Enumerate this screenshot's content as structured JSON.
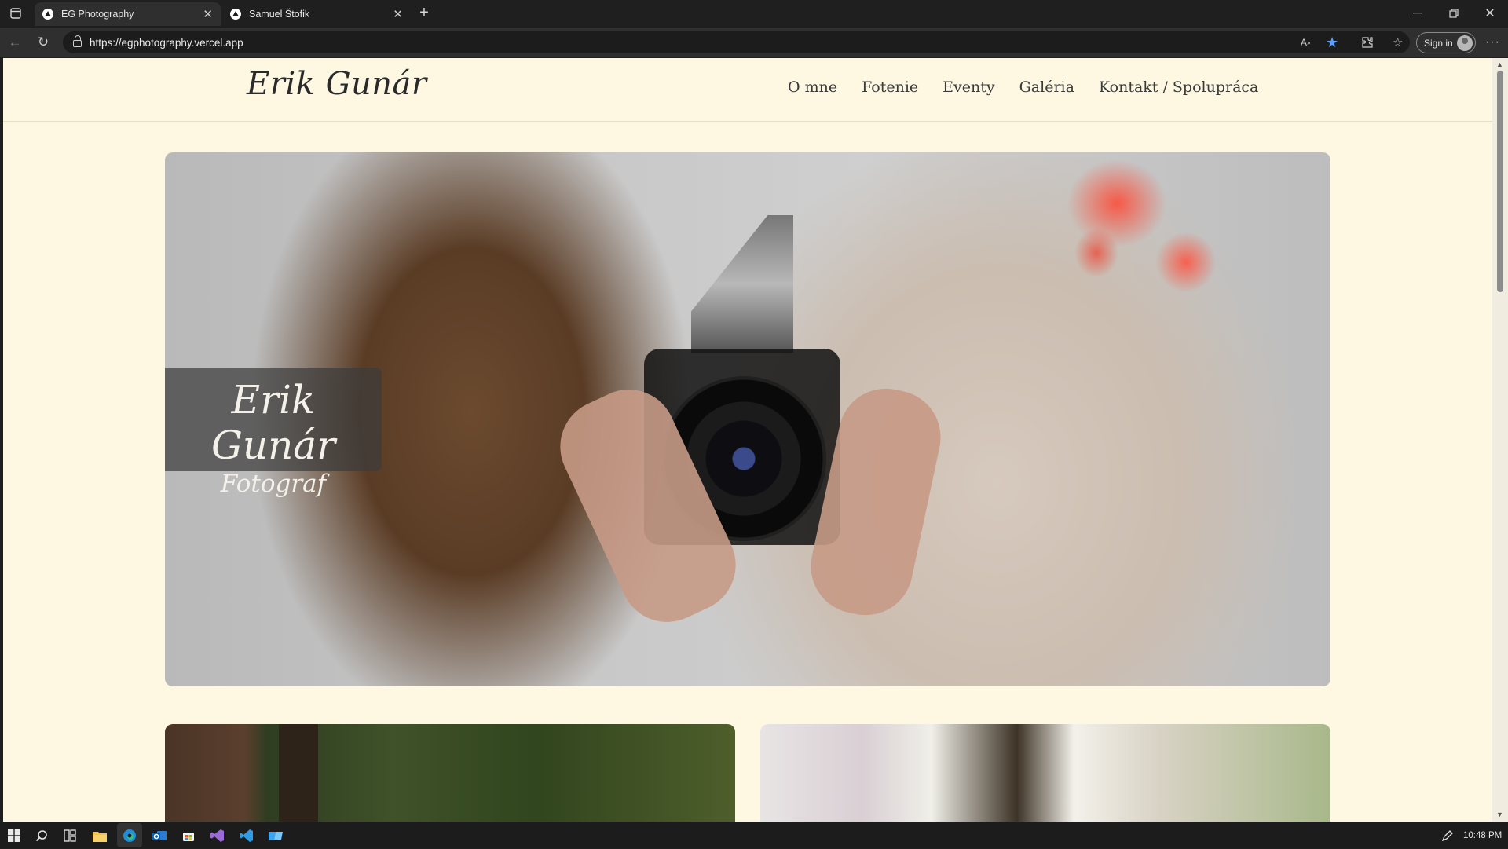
{
  "browser": {
    "tabs": [
      {
        "title": "EG Photography",
        "active": true
      },
      {
        "title": "Samuel Štofik",
        "active": false
      }
    ],
    "url": "https://egphotography.vercel.app",
    "signin_label": "Sign in"
  },
  "site": {
    "logo": "Erik Gunár",
    "nav": [
      "O mne",
      "Fotenie",
      "Eventy",
      "Galéria",
      "Kontakt / Spolupráca"
    ],
    "hero": {
      "title": "Erik Gunár",
      "subtitle": "Fotograf"
    }
  },
  "taskbar": {
    "time": "10:48 PM"
  },
  "colors": {
    "page_background": "#fef8e2",
    "chrome_dark": "#1f1f1f",
    "caption_overlay": "#3c3c3c"
  },
  "icons": [
    "sidebar-toggle-icon",
    "close-icon",
    "plus-icon",
    "minimize-icon",
    "restore-icon",
    "back-arrow-icon",
    "reload-icon",
    "lock-icon",
    "read-aloud-icon",
    "star-icon",
    "extensions-icon",
    "favorites-icon",
    "more-icon",
    "windows-start-icon",
    "search-icon",
    "task-view-icon",
    "file-explorer-icon",
    "edge-icon",
    "outlook-icon",
    "store-icon",
    "visual-studio-icon",
    "vscode-icon",
    "terminal-icon",
    "pen-icon"
  ]
}
